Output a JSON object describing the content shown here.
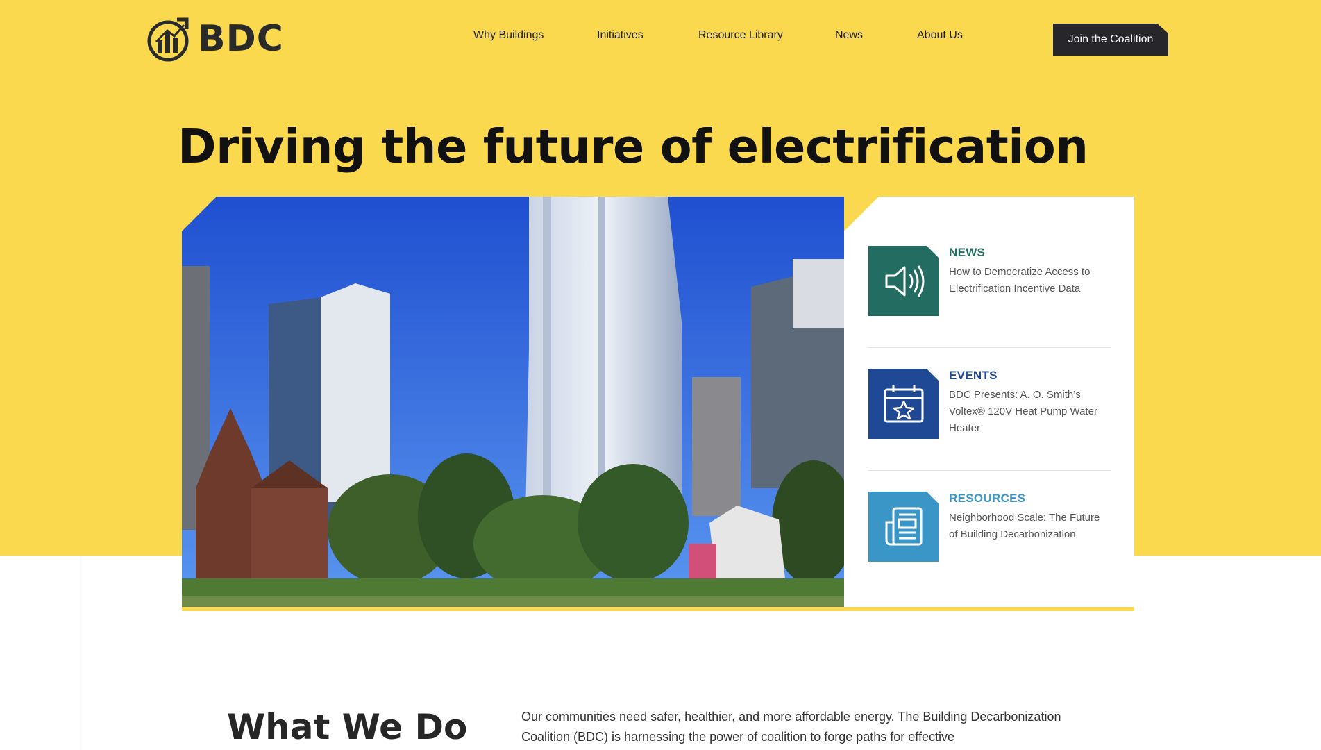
{
  "brand": {
    "name": "BDC",
    "logo_icon": "building-chart-icon"
  },
  "nav": {
    "items": [
      {
        "label": "Why Buildings"
      },
      {
        "label": "Initiatives"
      },
      {
        "label": "Resource Library"
      },
      {
        "label": "News"
      },
      {
        "label": "About Us"
      }
    ],
    "cta_label": "Join the Coalition"
  },
  "hero": {
    "title": "Driving the future of electrification",
    "image": "photo of San Francisco high-rise towers behind a brick church and a tree-filled park under a blue sky"
  },
  "cards": [
    {
      "category": "NEWS",
      "title": "How to Democratize Access to Electrification Incentive Data",
      "icon": "speaker-icon",
      "color": "#236c62"
    },
    {
      "category": "EVENTS",
      "title": "BDC Presents: A. O. Smith’s Voltex® 120V Heat Pump Water Heater",
      "icon": "calendar-star-icon",
      "color": "#1f4994"
    },
    {
      "category": "RESOURCES",
      "title": "Neighborhood Scale: The Future of Building Decarbonization",
      "icon": "newspaper-icon",
      "color": "#3b96c8"
    }
  ],
  "what_we_do": {
    "title": "What We Do",
    "text": "Our communities need safer, healthier, and more affordable energy. The Building Decarbonization Coalition (BDC) is harnessing the power of coalition to forge paths for effective"
  },
  "colors": {
    "accent": "#fad94e",
    "dark": "#26262b"
  }
}
